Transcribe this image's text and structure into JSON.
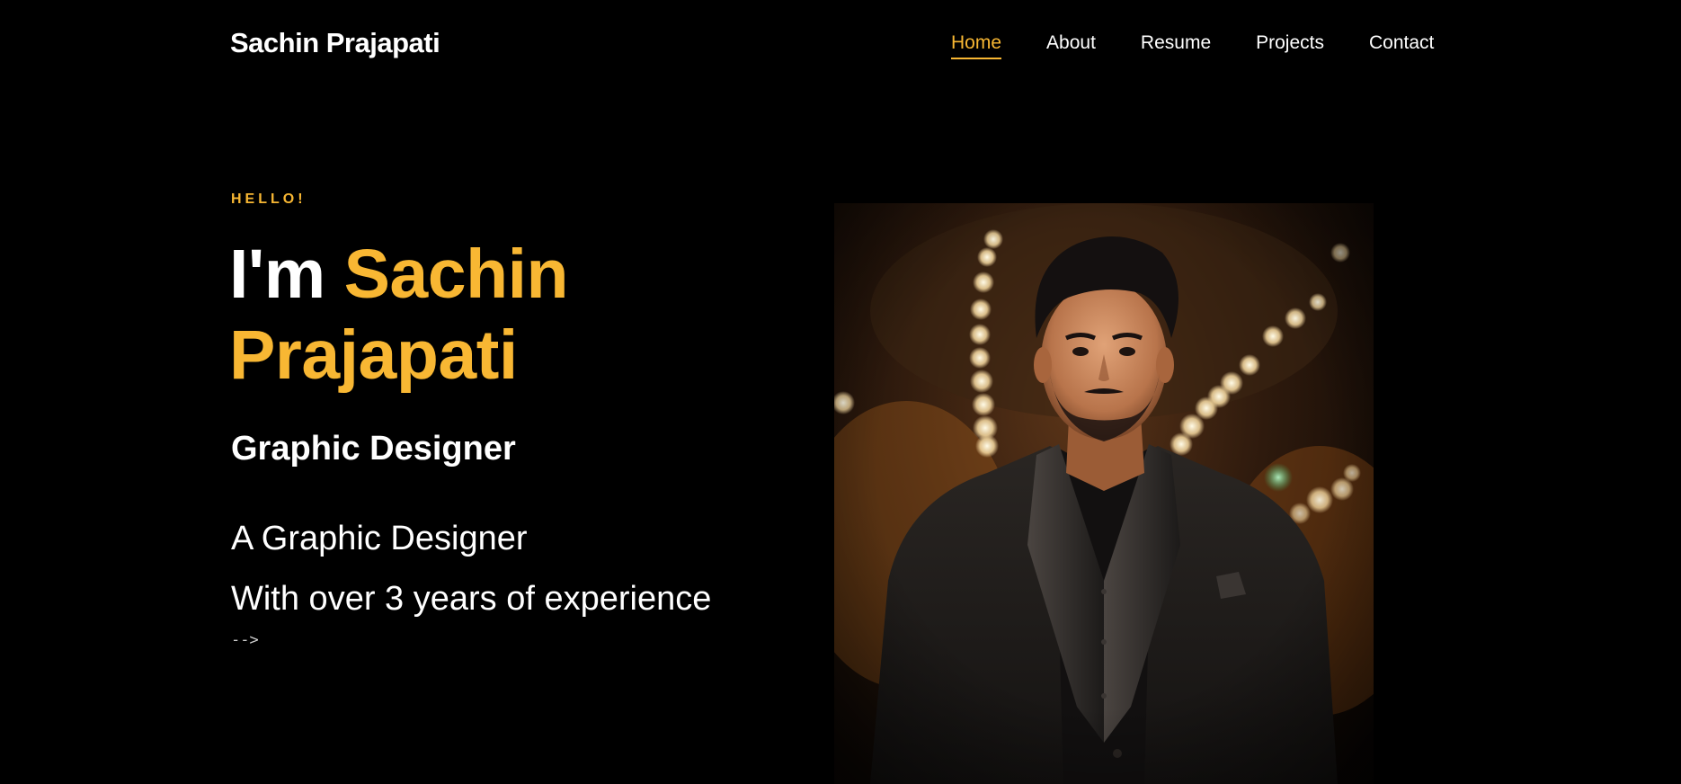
{
  "header": {
    "brand": "Sachin Prajapati",
    "nav": [
      {
        "label": "Home",
        "active": true
      },
      {
        "label": "About",
        "active": false
      },
      {
        "label": "Resume",
        "active": false
      },
      {
        "label": "Projects",
        "active": false
      },
      {
        "label": "Contact",
        "active": false
      }
    ]
  },
  "hero": {
    "greeting": "HELLO!",
    "intro": "I'm",
    "name": "Sachin Prajapati",
    "role": "Graphic Designer",
    "description_line1": "A Graphic Designer",
    "description_line2": "With over 3 years of experience",
    "stray_text": "-->"
  },
  "colors": {
    "accent": "#f8b733",
    "background": "#000000",
    "text": "#ffffff"
  }
}
